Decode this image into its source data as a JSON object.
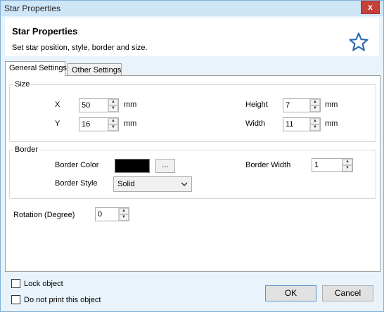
{
  "window": {
    "title": "Star Properties",
    "close_label": "x"
  },
  "header": {
    "title": "Star Properties",
    "description": "Set star position, style, border and size.",
    "icon": "star-outline-icon",
    "icon_color": "#2b6db5"
  },
  "tabs": [
    {
      "label": "General Settings",
      "active": true
    },
    {
      "label": "Other Settings",
      "active": false
    }
  ],
  "size_group": {
    "legend": "Size",
    "x": {
      "label": "X",
      "value": "50",
      "unit": "mm"
    },
    "y": {
      "label": "Y",
      "value": "16",
      "unit": "mm"
    },
    "height": {
      "label": "Height",
      "value": "7",
      "unit": "mm"
    },
    "width": {
      "label": "Width",
      "value": "11",
      "unit": "mm"
    }
  },
  "border_group": {
    "legend": "Border",
    "color_label": "Border Color",
    "color_value": "#000000",
    "color_button": "...",
    "style_label": "Border Style",
    "style_value": "Solid",
    "width_label": "Border Width",
    "width_value": "1"
  },
  "rotation": {
    "label": "Rotation (Degree)",
    "value": "0"
  },
  "options": {
    "lock_label": "Lock object",
    "lock_checked": false,
    "noprint_label": "Do not print this object",
    "noprint_checked": false
  },
  "buttons": {
    "ok": "OK",
    "cancel": "Cancel"
  }
}
